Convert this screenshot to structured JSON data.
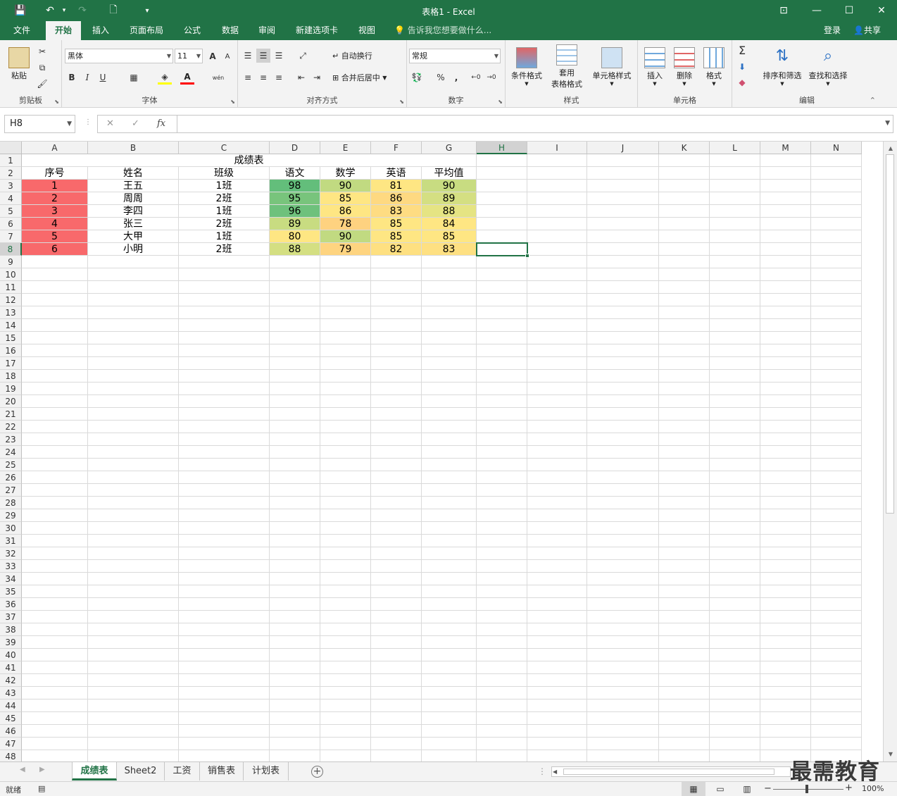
{
  "titlebar": {
    "title": "表格1 - Excel",
    "save_icon": "💾",
    "undo_icon": "↶",
    "redo_icon": "↷",
    "new_icon": "🗋",
    "customize_icon": "▾",
    "ribbon_display_icon": "⊡",
    "minimize_icon": "—",
    "maximize_icon": "☐",
    "close_icon": "✕"
  },
  "tabs": [
    "文件",
    "开始",
    "插入",
    "页面布局",
    "公式",
    "数据",
    "审阅",
    "新建选项卡",
    "视图"
  ],
  "active_tab": "开始",
  "tell_me": "告诉我您想要做什么...",
  "login": "登录",
  "share": "共享",
  "ribbon": {
    "clipboard": {
      "label": "剪贴板",
      "paste": "粘贴"
    },
    "font": {
      "label": "字体",
      "name": "黑体",
      "size": "11",
      "bold": "B",
      "italic": "I",
      "underline": "U",
      "grow": "A",
      "shrink": "A",
      "font_color_letter": "A",
      "phonetic": "wén"
    },
    "alignment": {
      "label": "对齐方式",
      "wrap": "自动换行",
      "merge": "合并后居中"
    },
    "number": {
      "label": "数字",
      "format": "常规",
      "percent": "%",
      "comma": ","
    },
    "styles": {
      "label": "样式",
      "conditional": "条件格式",
      "table_1": "套用",
      "table_2": "表格格式",
      "cell_styles": "单元格样式"
    },
    "cells": {
      "label": "单元格",
      "insert": "插入",
      "delete": "删除",
      "format": "格式"
    },
    "editing": {
      "label": "编辑",
      "sort": "排序和筛选",
      "find": "查找和选择"
    }
  },
  "formula_bar": {
    "name_box": "H8",
    "formula": "",
    "cancel": "✕",
    "enter": "✓",
    "fx": "fx"
  },
  "columns": [
    "A",
    "B",
    "C",
    "D",
    "E",
    "F",
    "G",
    "H",
    "I",
    "J",
    "K",
    "L",
    "M",
    "N"
  ],
  "selected_cell": "H8",
  "title_cell": "成绩表",
  "headers": [
    "序号",
    "姓名",
    "班级",
    "语文",
    "数学",
    "英语",
    "平均值"
  ],
  "rows": [
    [
      "1",
      "王五",
      "1班",
      "98",
      "90",
      "81",
      "90"
    ],
    [
      "2",
      "周周",
      "2班",
      "95",
      "85",
      "86",
      "89"
    ],
    [
      "3",
      "李四",
      "1班",
      "96",
      "86",
      "83",
      "88"
    ],
    [
      "4",
      "张三",
      "2班",
      "89",
      "78",
      "85",
      "84"
    ],
    [
      "5",
      "大甲",
      "1班",
      "80",
      "90",
      "85",
      "85"
    ],
    [
      "6",
      "小明",
      "2班",
      "88",
      "79",
      "82",
      "83"
    ]
  ],
  "colors": {
    "accent": "#217346",
    "index_fill": "#f8696b",
    "score_fills": [
      [
        "#63be7b",
        "#c1da81",
        "#fee683",
        "#c8dc81"
      ],
      [
        "#78c47c",
        "#fee683",
        "#fed981",
        "#d4df82"
      ],
      [
        "#6ec17c",
        "#fee683",
        "#fedc82",
        "#e5e483"
      ],
      [
        "#c8dc81",
        "#fed280",
        "#fee683",
        "#fee683"
      ],
      [
        "#fee683",
        "#c1da81",
        "#fee683",
        "#fee683"
      ],
      [
        "#d4df82",
        "#fed480",
        "#fee081",
        "#fee082"
      ]
    ]
  },
  "row_count": 48,
  "sheets": [
    "成绩表",
    "Sheet2",
    "工资",
    "销售表",
    "计划表"
  ],
  "active_sheet": "成绩表",
  "watermark": "最需教育",
  "status": {
    "ready": "就绪",
    "zoom": "100%"
  }
}
